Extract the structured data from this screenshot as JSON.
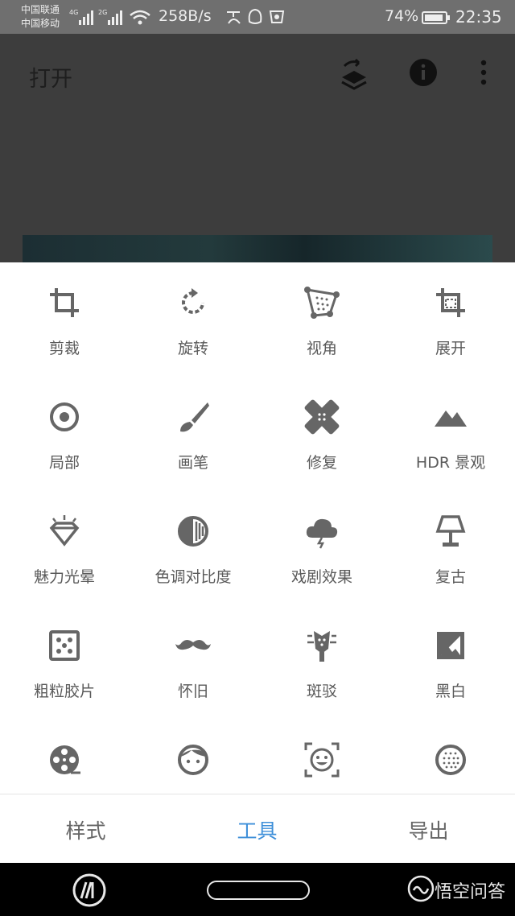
{
  "status_bar": {
    "carrier_1": "中国联通",
    "carrier_2": "中国移动",
    "net_speed": "258B/s",
    "battery_percent": "74%",
    "time": "22:35"
  },
  "app_bar": {
    "open_label": "打开",
    "icons": [
      "layers-undo-icon",
      "info-icon",
      "more-vert-icon"
    ]
  },
  "tools": [
    {
      "label": "剪裁",
      "icon": "crop-icon"
    },
    {
      "label": "旋转",
      "icon": "rotate-icon"
    },
    {
      "label": "视角",
      "icon": "perspective-icon"
    },
    {
      "label": "展开",
      "icon": "expand-icon"
    },
    {
      "label": "局部",
      "icon": "selective-icon"
    },
    {
      "label": "画笔",
      "icon": "brush-icon"
    },
    {
      "label": "修复",
      "icon": "healing-icon"
    },
    {
      "label": "HDR 景观",
      "icon": "hdr-mountain-icon"
    },
    {
      "label": "魅力光晕",
      "icon": "glamour-diamond-icon"
    },
    {
      "label": "色调对比度",
      "icon": "tonal-contrast-icon"
    },
    {
      "label": "戏剧效果",
      "icon": "drama-cloud-icon"
    },
    {
      "label": "复古",
      "icon": "vintage-lamp-icon"
    },
    {
      "label": "粗粒胶片",
      "icon": "grainy-film-icon"
    },
    {
      "label": "怀旧",
      "icon": "retrolux-mustache-icon"
    },
    {
      "label": "斑驳",
      "icon": "grunge-guitar-icon"
    },
    {
      "label": "黑白",
      "icon": "black-white-icon"
    },
    {
      "label": "",
      "icon": "film-reel-icon"
    },
    {
      "label": "",
      "icon": "face-icon"
    },
    {
      "label": "",
      "icon": "face-frame-icon"
    },
    {
      "label": "",
      "icon": "dotted-circle-icon"
    }
  ],
  "bottom_tabs": {
    "styles": "样式",
    "tools": "工具",
    "export": "导出",
    "active": "tools"
  },
  "nav_bar": {
    "watermark": "悟空问答"
  },
  "colors": {
    "active_tab": "#3e8fd9",
    "icon": "#666666",
    "overlay": "#3d3d3d"
  }
}
